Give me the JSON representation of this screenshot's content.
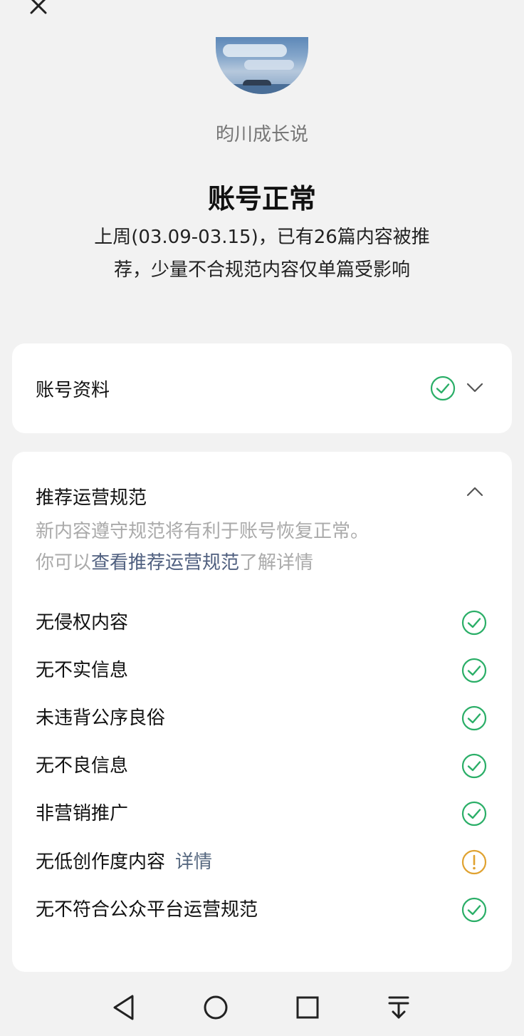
{
  "header": {
    "close_icon": "close-icon"
  },
  "profile": {
    "avatar": "avatar-sky-sea",
    "name": "昀川成长说"
  },
  "status": {
    "title": "账号正常",
    "description": "上周(03.09-03.15)，已有26篇内容被推荐，少量不合规范内容仅单篇受影响"
  },
  "account_card": {
    "label": "账号资料",
    "status_icon": "check-circle-icon",
    "toggle_icon": "chevron-down-icon"
  },
  "rules_card": {
    "title": "推荐运营规范",
    "toggle_icon": "chevron-up-icon",
    "desc_line1": "新内容遵守规范将有利于账号恢复正常。",
    "desc_line2_prefix": "你可以",
    "desc_link": "查看推荐运营规范",
    "desc_line2_suffix": "了解详情",
    "rules": [
      {
        "label": "无侵权内容",
        "status": "ok",
        "icon": "check-circle-icon"
      },
      {
        "label": "无不实信息",
        "status": "ok",
        "icon": "check-circle-icon"
      },
      {
        "label": "未违背公序良俗",
        "status": "ok",
        "icon": "check-circle-icon"
      },
      {
        "label": "无不良信息",
        "status": "ok",
        "icon": "check-circle-icon"
      },
      {
        "label": "非营销推广",
        "status": "ok",
        "icon": "check-circle-icon"
      },
      {
        "label": "无低创作度内容",
        "detail": "详情",
        "status": "warning",
        "icon": "warning-circle-icon"
      },
      {
        "label": "无不符合公众平台运营规范",
        "status": "ok",
        "icon": "check-circle-icon"
      }
    ]
  },
  "colors": {
    "ok": "#2aae67",
    "warning": "#e0a230",
    "link": "#4f5f7f",
    "background": "#f2f2f2"
  },
  "navbar": {
    "back_icon": "back-triangle-icon",
    "home_icon": "home-circle-icon",
    "recents_icon": "recents-square-icon",
    "menu_icon": "menu-down-icon"
  }
}
